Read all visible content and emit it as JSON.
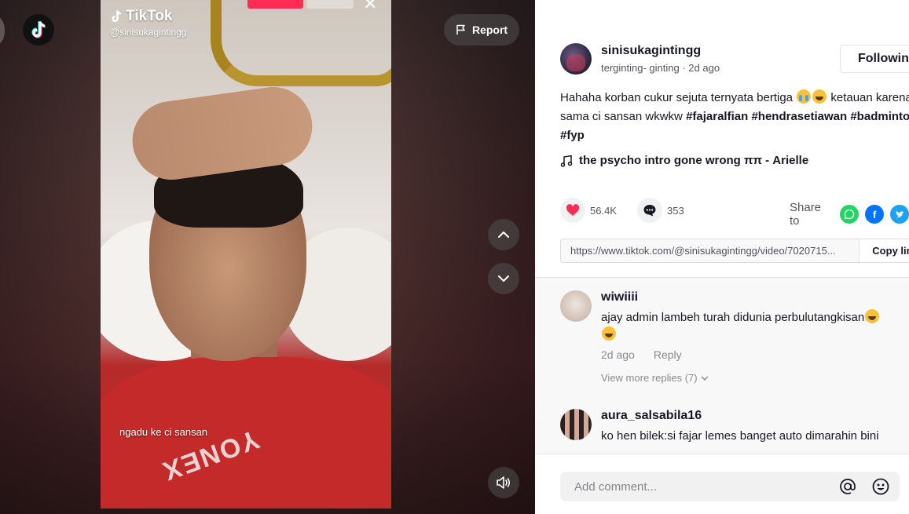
{
  "video": {
    "watermark_brand": "TikTok",
    "watermark_user": "@sinisukagintingg",
    "caption": "ngadu ke ci sansan",
    "shirt_brand": "YONEX"
  },
  "controls": {
    "report_label": "Report"
  },
  "author": {
    "username": "sinisukagintingg",
    "nickname": "terginting- ginting",
    "separator": " · ",
    "time": "2d ago",
    "follow_label": "Following"
  },
  "description": {
    "line1_text": "Hahaha korban cukur sejuta ternyata bertiga ",
    "line1_tail": " ketauan karena ngadu",
    "line2_text": "sama ci sansan wkwkw ",
    "tags": [
      "#fajaralfian",
      "#hendrasetiawan",
      "#badminton",
      "#fyp"
    ]
  },
  "music": {
    "title": "the psycho intro gone wrong ππ - Arielle"
  },
  "stats": {
    "likes": "56.4K",
    "comments": "353",
    "share_label": "Share to"
  },
  "link": {
    "url": "https://www.tiktok.com/@sinisukagintingg/video/7020715...",
    "copy_label": "Copy link"
  },
  "comments": [
    {
      "user": "wiwiiii",
      "text": "ajay admin lambeh turah didunia perbulutangkisan",
      "time": "2d ago",
      "reply_label": "Reply",
      "more_replies": "View more replies (7)"
    },
    {
      "user": "aura_salsabila16",
      "text": "ko hen bilek:si fajar lemes banget auto dimarahin bini"
    }
  ],
  "input": {
    "placeholder": "Add comment..."
  },
  "colors": {
    "brand_red": "#fe2c55",
    "like_red": "#fe2c55",
    "whatsapp": "#25d366",
    "facebook": "#0075fa",
    "twitter": "#1da1f2"
  }
}
